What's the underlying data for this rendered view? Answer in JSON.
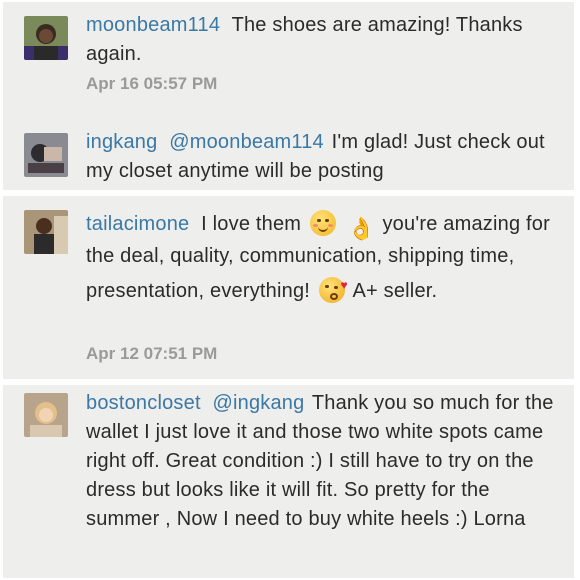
{
  "comments": [
    {
      "user": "moonbeam114",
      "mention": "",
      "text": "The shoes are amazing! Thanks again.",
      "time": "Apr 16 05:57 PM",
      "avatar_color": "#4b3a2e"
    },
    {
      "user": "ingkang",
      "mention": "@moonbeam114",
      "text": "I'm glad! Just check out my closet anytime will be posting",
      "time": "",
      "avatar_color": "#5a5560"
    },
    {
      "user": "tailacimone",
      "mention": "",
      "text_part1": "I love them",
      "text_part2": "you're amazing for the deal, quality, communication, shipping time,",
      "text_part3": "presentation, everything!",
      "text_part4": "A+ seller.",
      "time": "Apr 12 07:51 PM",
      "emojis": [
        "smiling-face-icon",
        "ok-hand-icon",
        "kissing-face-icon"
      ],
      "avatar_color": "#7a5a3e"
    },
    {
      "user": "bostoncloset",
      "mention": "@ingkang",
      "text": "Thank you so much for the wallet I just love it and those two white spots came right off. Great condition :) I still have to try on the dress but looks like it will fit. So pretty for the summer , Now I need to buy white heels :) Lorna",
      "time": "",
      "avatar_color": "#c8a070"
    }
  ]
}
